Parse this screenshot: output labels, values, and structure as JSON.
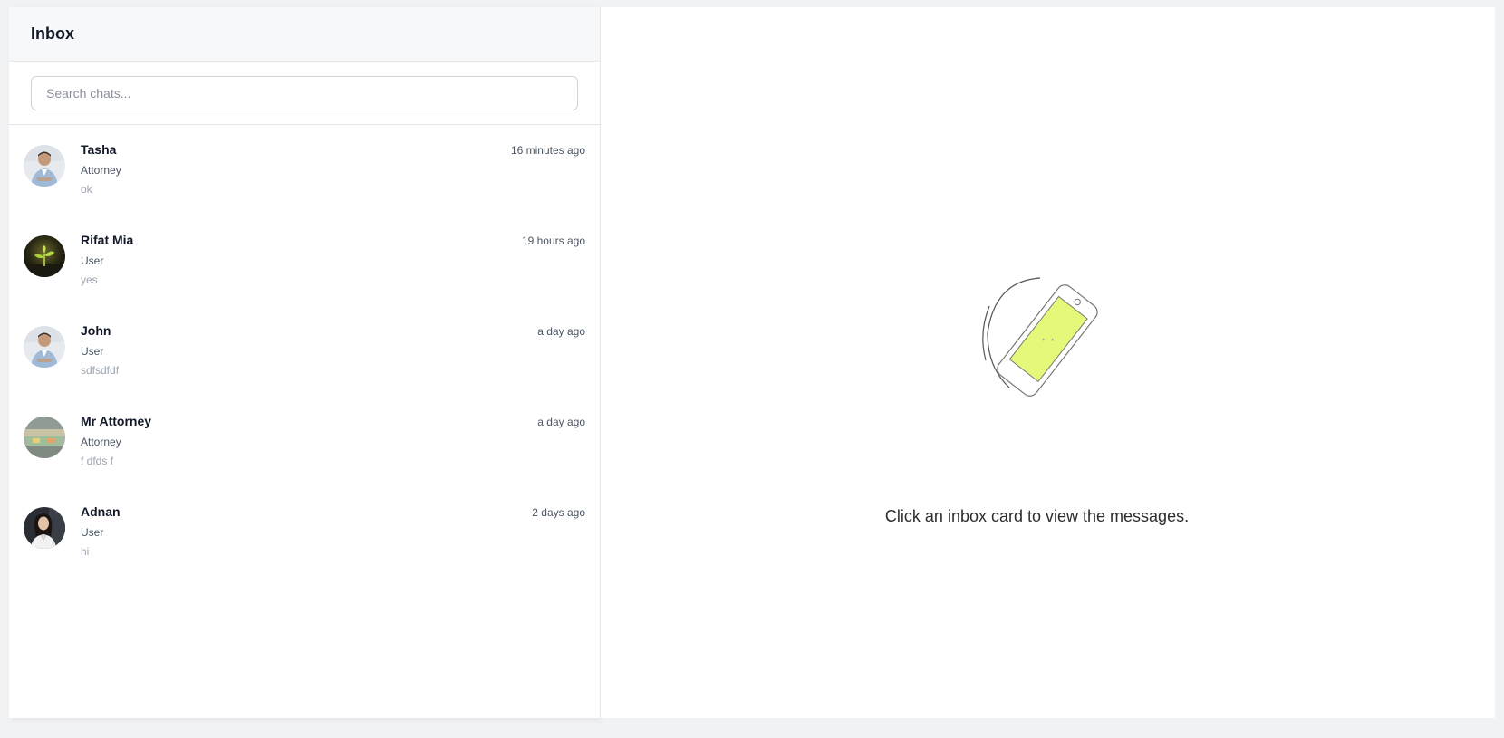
{
  "sidebar": {
    "title": "Inbox",
    "search": {
      "placeholder": "Search chats...",
      "value": ""
    },
    "chats": [
      {
        "name": "Tasha",
        "role": "Attorney",
        "preview": "ok",
        "time": "16 minutes ago",
        "avatar": "man-in-shirt-photo"
      },
      {
        "name": "Rifat Mia",
        "role": "User",
        "preview": "yes",
        "time": "19 hours ago",
        "avatar": "plant-sprout-photo"
      },
      {
        "name": "John",
        "role": "User",
        "preview": "sdfsdfdf",
        "time": "a day ago",
        "avatar": "man-in-shirt-photo"
      },
      {
        "name": "Mr Attorney",
        "role": "Attorney",
        "preview": "f dfds f",
        "time": "a day ago",
        "avatar": "blurred-landscape-photo"
      },
      {
        "name": "Adnan",
        "role": "User",
        "preview": "hi",
        "time": "2 days ago",
        "avatar": "woman-portrait-photo"
      }
    ]
  },
  "main": {
    "empty_message": "Click an inbox card to view the messages.",
    "illustration": "rotating-phone-icon",
    "illustration_color": "#e5f87a"
  }
}
